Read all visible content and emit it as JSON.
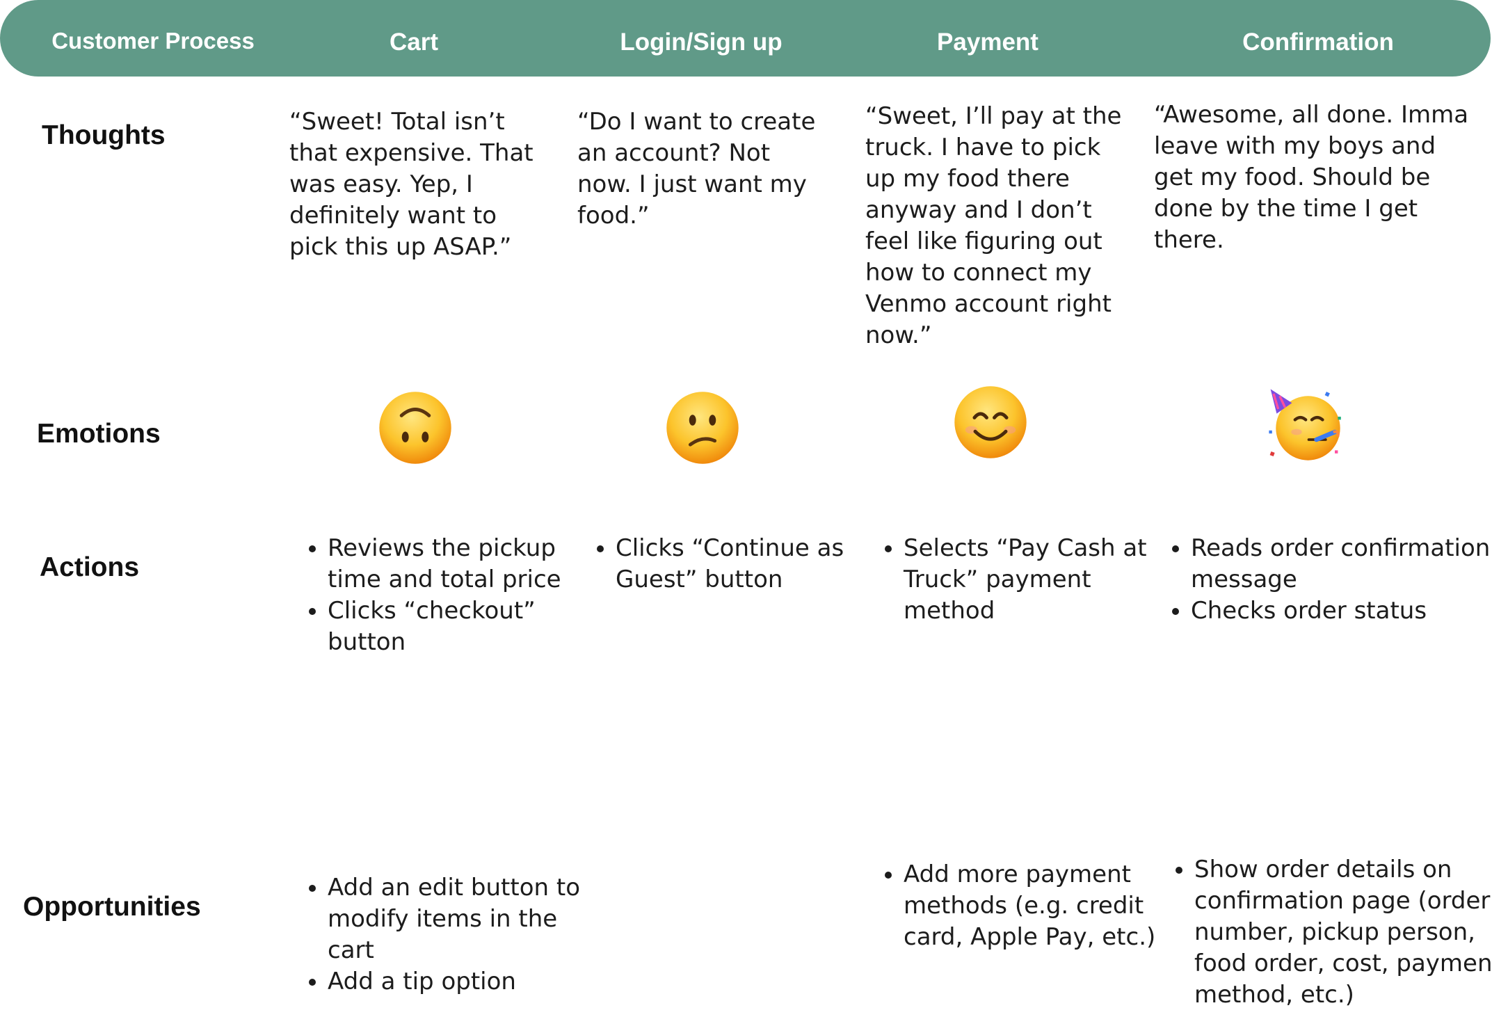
{
  "header": {
    "process_label": "Customer Process",
    "stages": [
      "Cart",
      "Login/Sign up",
      "Payment",
      "Confirmation"
    ]
  },
  "rows": {
    "thoughts_label": "Thoughts",
    "emotions_label": "Emotions",
    "actions_label": "Actions",
    "opportunities_label": "Opportunities"
  },
  "thoughts": {
    "cart": "“Sweet! Total isn’t that expensive. That was easy. Yep, I definitely want to pick this up ASAP.”",
    "login": "“Do I want to create an account? Not now. I just want my food.”",
    "payment": "“Sweet, I’ll pay at the truck. I have to pick up my food there anyway and I don’t feel like figuring out how to connect my Venmo account right now.”",
    "confirmation": "“Awesome, all done. Imma leave with my boys and get my food. Should be done by the time I get there."
  },
  "emotions": {
    "cart": "upside-down-face-icon",
    "login": "confused-face-icon",
    "payment": "smiling-face-with-smiling-eyes-icon",
    "confirmation": "partying-face-icon"
  },
  "actions": {
    "cart": [
      "Reviews the pickup time and total price",
      "Clicks “checkout” button"
    ],
    "login": [
      "Clicks “Continue as Guest” button"
    ],
    "payment": [
      "Selects “Pay Cash at Truck” payment method"
    ],
    "confirmation": [
      "Reads order confirmation message",
      "Checks order status"
    ]
  },
  "opportunities": {
    "cart": [
      "Add an edit button to modify items in the cart",
      "Add a tip option"
    ],
    "payment": [
      "Add more payment methods (e.g. credit card, Apple Pay, etc.)"
    ],
    "confirmation": [
      "Show order details on confirmation page (order number, pickup person, food order, cost, payment method, etc.)"
    ]
  },
  "colors": {
    "header_bg": "#609a88",
    "header_text": "#ffffff",
    "emoji_face": "#fbbf24"
  }
}
